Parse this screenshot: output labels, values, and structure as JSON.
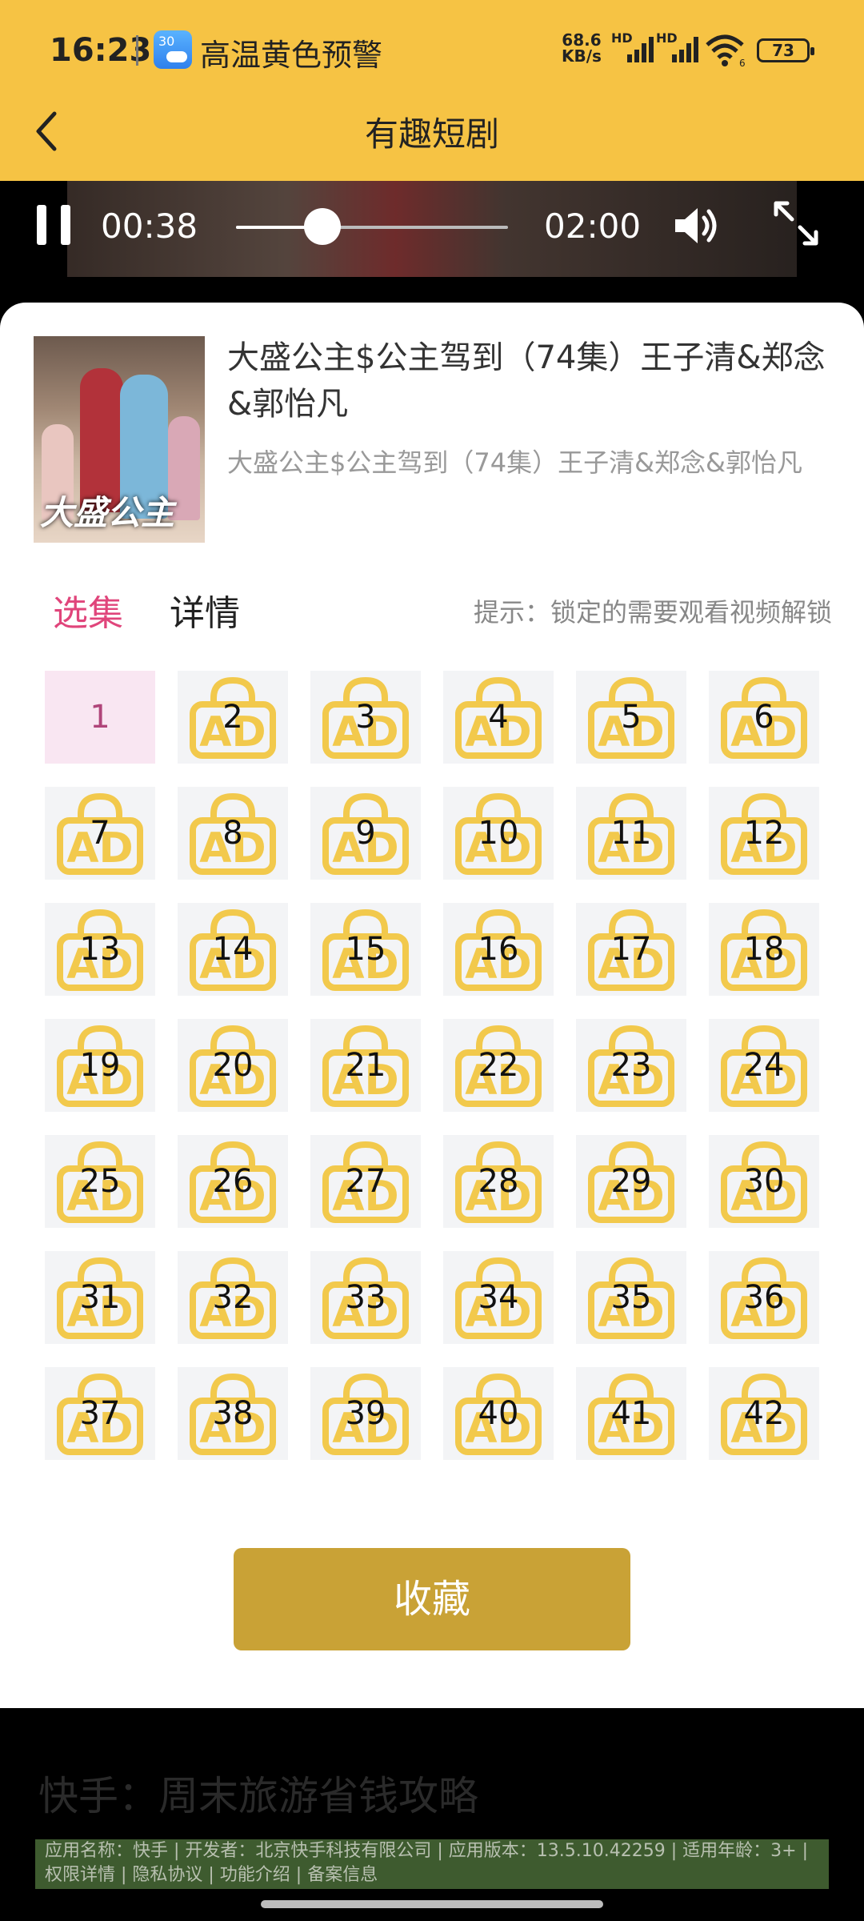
{
  "status_bar": {
    "time": "16:23",
    "weather_badge": "30",
    "alert": "高温黄色预警",
    "net_speed_value": "68.6",
    "net_speed_unit": "KB/s",
    "sig1_label": "HD",
    "sig2_label": "HD",
    "wifi_badge": "6",
    "battery": "73"
  },
  "header": {
    "title": "有趣短剧"
  },
  "player": {
    "current_time": "00:38",
    "total_time": "02:00",
    "progress_fraction": 0.317
  },
  "drama": {
    "title": "大盛公主$公主驾到（74集）王子清&郑念&郭怡凡",
    "subtitle": "大盛公主$公主驾到（74集）王子清&郑念&郭怡凡",
    "poster_text": "大盛公主"
  },
  "tabs": [
    {
      "label": "选集",
      "active": true
    },
    {
      "label": "详情",
      "active": false
    }
  ],
  "hint": "提示：锁定的需要观看视频解锁",
  "episodes": [
    {
      "n": "1",
      "locked": false
    },
    {
      "n": "2",
      "locked": true
    },
    {
      "n": "3",
      "locked": true
    },
    {
      "n": "4",
      "locked": true
    },
    {
      "n": "5",
      "locked": true
    },
    {
      "n": "6",
      "locked": true
    },
    {
      "n": "7",
      "locked": true
    },
    {
      "n": "8",
      "locked": true
    },
    {
      "n": "9",
      "locked": true
    },
    {
      "n": "10",
      "locked": true
    },
    {
      "n": "11",
      "locked": true
    },
    {
      "n": "12",
      "locked": true
    },
    {
      "n": "13",
      "locked": true
    },
    {
      "n": "14",
      "locked": true
    },
    {
      "n": "15",
      "locked": true
    },
    {
      "n": "16",
      "locked": true
    },
    {
      "n": "17",
      "locked": true
    },
    {
      "n": "18",
      "locked": true
    },
    {
      "n": "19",
      "locked": true
    },
    {
      "n": "20",
      "locked": true
    },
    {
      "n": "21",
      "locked": true
    },
    {
      "n": "22",
      "locked": true
    },
    {
      "n": "23",
      "locked": true
    },
    {
      "n": "24",
      "locked": true
    },
    {
      "n": "25",
      "locked": true
    },
    {
      "n": "26",
      "locked": true
    },
    {
      "n": "27",
      "locked": true
    },
    {
      "n": "28",
      "locked": true
    },
    {
      "n": "29",
      "locked": true
    },
    {
      "n": "30",
      "locked": true
    },
    {
      "n": "31",
      "locked": true
    },
    {
      "n": "32",
      "locked": true
    },
    {
      "n": "33",
      "locked": true
    },
    {
      "n": "34",
      "locked": true
    },
    {
      "n": "35",
      "locked": true
    },
    {
      "n": "36",
      "locked": true
    },
    {
      "n": "37",
      "locked": true
    },
    {
      "n": "38",
      "locked": true
    },
    {
      "n": "39",
      "locked": true
    },
    {
      "n": "40",
      "locked": true
    },
    {
      "n": "41",
      "locked": true
    },
    {
      "n": "42",
      "locked": true
    }
  ],
  "lock_icon_text": "AD",
  "favorite_button": "收藏",
  "ad": {
    "title": "快手：周末旅游省钱攻略",
    "info_line1": "应用名称：快手 | 开发者：北京快手科技有限公司 | 应用版本：13.5.10.42259 | 适用年龄：3+ |",
    "info_line2": "权限详情 | 隐私协议 | 功能介绍 | 备案信息"
  },
  "colors": {
    "header_bg": "#F6C344",
    "active_tab": "#E0457B",
    "lock_icon": "#F2C94C",
    "favorite_bg": "#C9A236"
  }
}
